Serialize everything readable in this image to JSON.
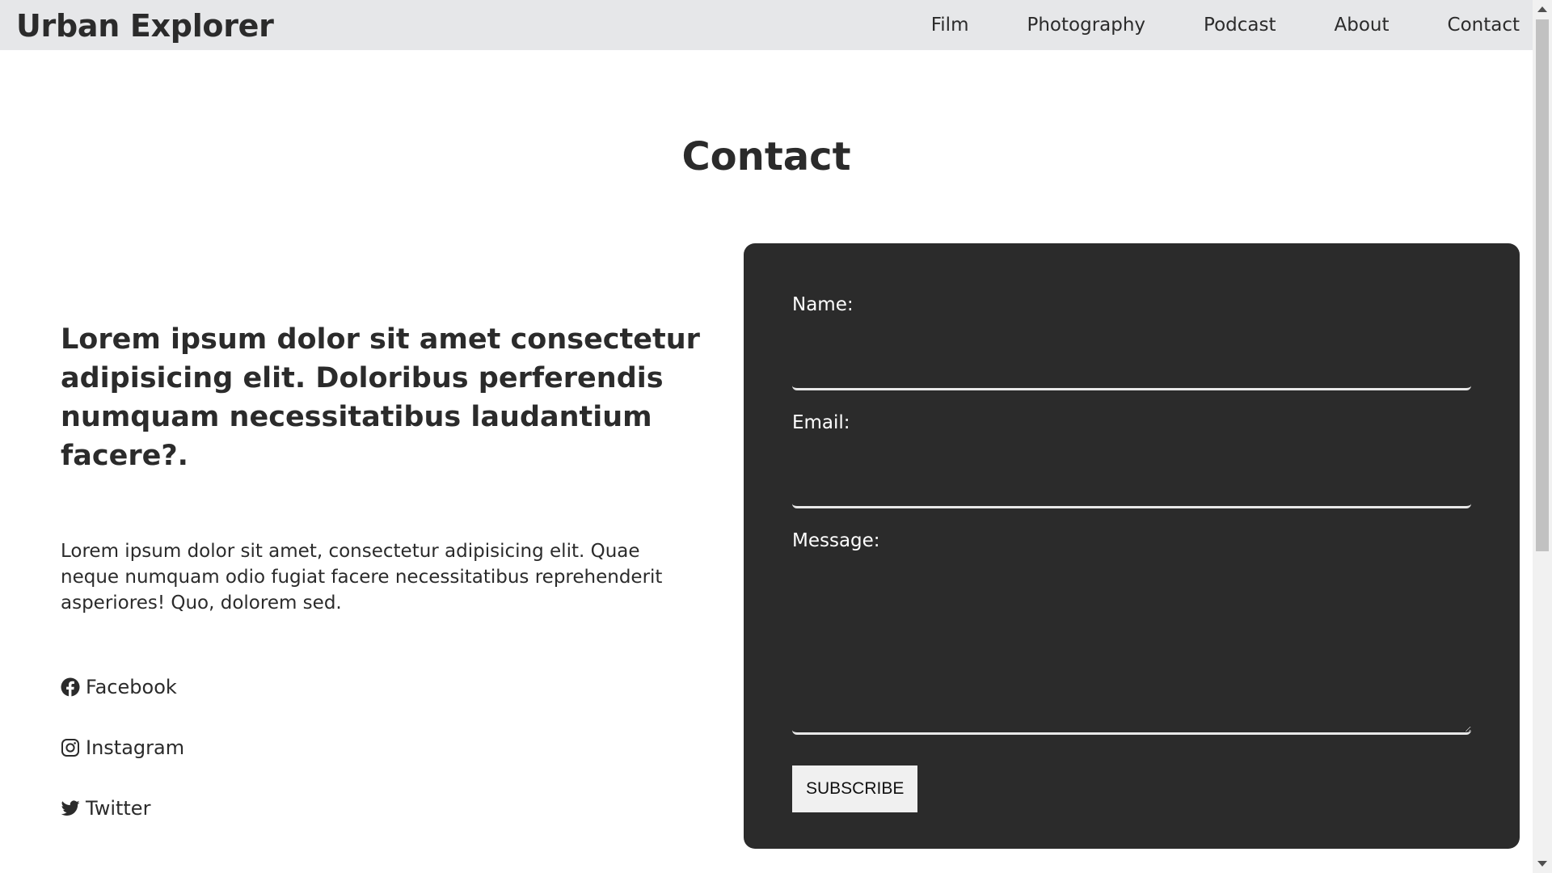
{
  "header": {
    "brand": "Urban Explorer",
    "nav": [
      "Film",
      "Photography",
      "Podcast",
      "About",
      "Contact"
    ]
  },
  "page": {
    "title": "Contact"
  },
  "intro": {
    "headline": "Lorem ipsum dolor sit amet consectetur adipisicing elit. Doloribus perferendis numquam necessitatibus laudantium facere?.",
    "body": "Lorem ipsum dolor sit amet, consectetur adipisicing elit. Quae neque numquam odio fugiat facere necessitatibus reprehenderit asperiores! Quo, dolorem sed."
  },
  "socials": [
    {
      "label": "Facebook",
      "icon": "facebook-icon"
    },
    {
      "label": "Instagram",
      "icon": "instagram-icon"
    },
    {
      "label": "Twitter",
      "icon": "twitter-icon"
    }
  ],
  "form": {
    "name_label": "Name:",
    "name_value": "",
    "email_label": "Email:",
    "email_value": "",
    "message_label": "Message:",
    "message_value": "",
    "submit_label": "SUBSCRIBE"
  },
  "colors": {
    "header_bg": "#e6e7e9",
    "card_bg": "#2b2b2b",
    "text": "#2b2b2b",
    "button_bg": "#f0f0f0"
  }
}
